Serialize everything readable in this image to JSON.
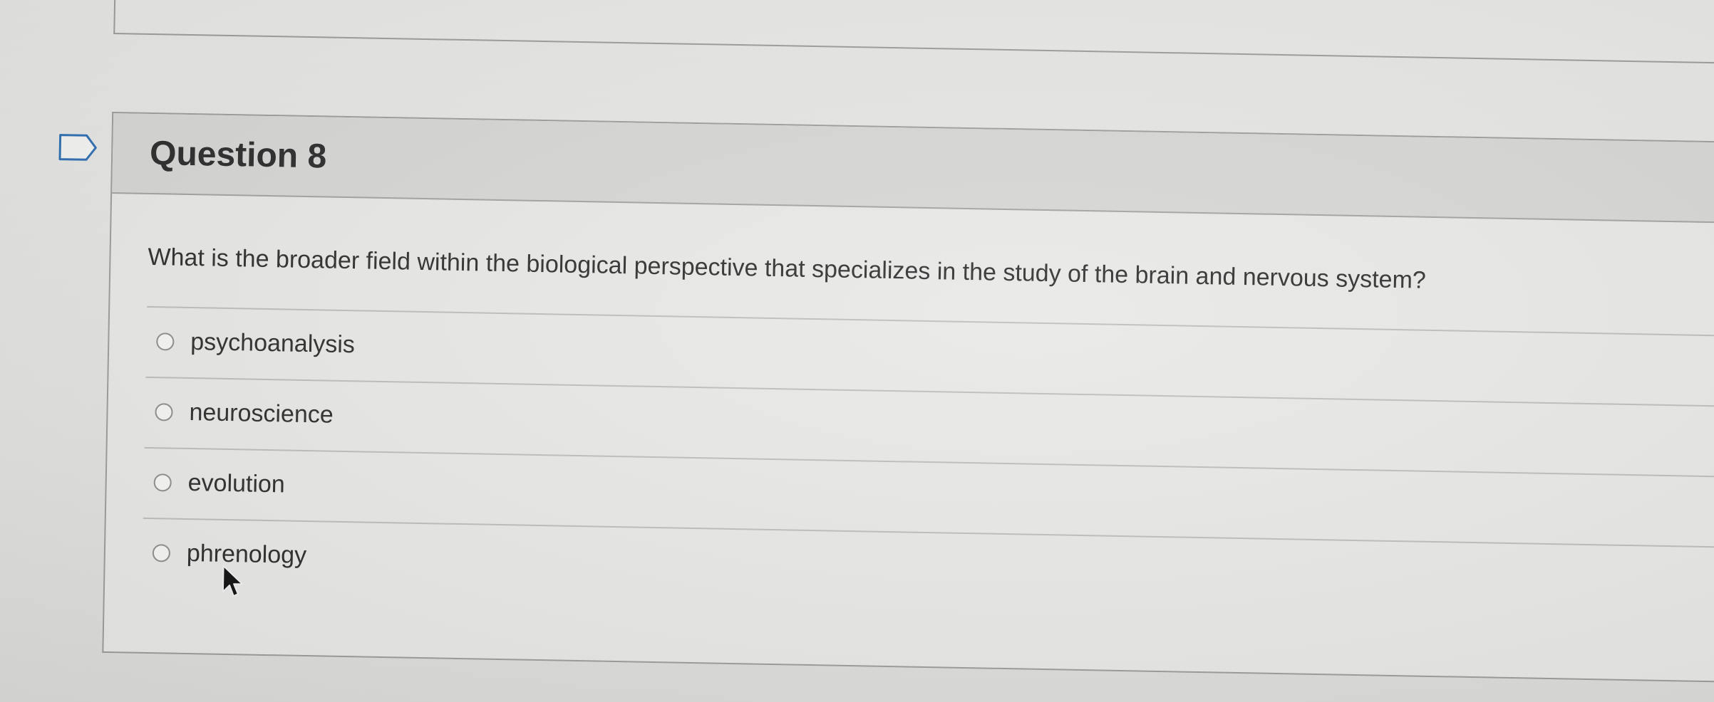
{
  "question": {
    "title": "Question 8",
    "text": "What is the broader field within the biological perspective that specializes in the study of the brain and nervous system?",
    "options": [
      {
        "label": "psychoanalysis",
        "selected": false
      },
      {
        "label": "neuroscience",
        "selected": false
      },
      {
        "label": "evolution",
        "selected": false
      },
      {
        "label": "phrenology",
        "selected": false
      }
    ]
  },
  "icons": {
    "flag": "flag-question-icon",
    "cursor": "mouse-pointer-icon"
  },
  "colors": {
    "header_bg": "#d6d6d4",
    "card_bg": "#e8e8e6",
    "border": "#9c9c9c",
    "text": "#2d2d2d"
  }
}
